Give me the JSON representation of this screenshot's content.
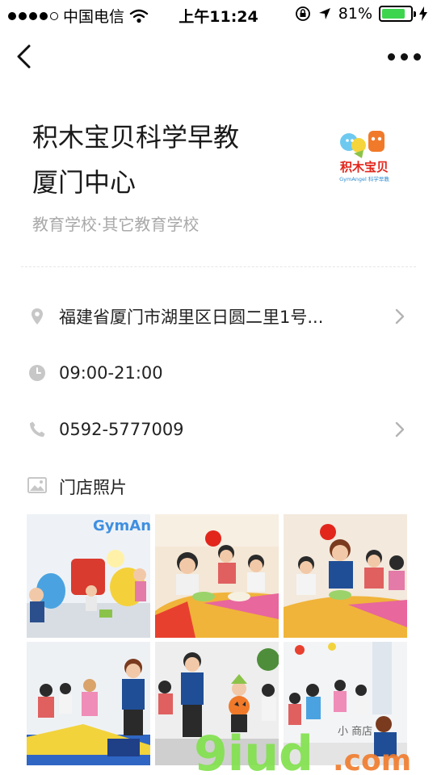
{
  "status_bar": {
    "carrier": "中国电信",
    "time": "上午11:24",
    "battery_percent": "81%",
    "battery_level": 0.81
  },
  "nav": {
    "back_icon": "chevron-left-icon",
    "more_icon": "ellipsis-icon"
  },
  "store": {
    "title_line1": "积木宝贝科学早教",
    "title_line2": "厦门中心",
    "category": "教育学校·其它教育学校",
    "logo_text": "积木宝贝",
    "logo_subtext": "GymAngel 科学早教"
  },
  "info": {
    "address": "福建省厦门市湖里区日圆二里1号...",
    "hours": "09:00-21:00",
    "phone": "0592-5777009"
  },
  "photos": {
    "label": "门店照片",
    "sign_text": "GymAng"
  },
  "watermark": {
    "text": "9iud",
    "suffix": ".com",
    "small_text": "小 商店"
  },
  "colors": {
    "accent_green": "#3dd54e",
    "icon_gray": "#c7c7c7",
    "secondary_text": "#a9a9a9"
  }
}
